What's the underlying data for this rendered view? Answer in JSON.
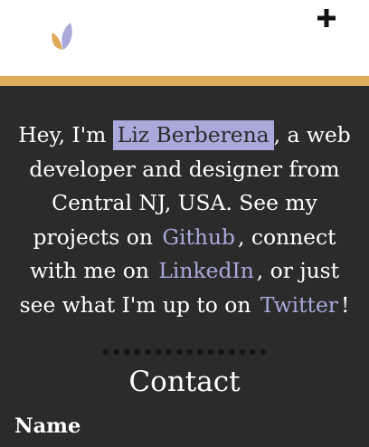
{
  "header": {
    "logo_icon": "leaf-logo-icon",
    "menu_icon": "plus-icon"
  },
  "colors": {
    "header_bg": "#ffffff",
    "accent_bar": "#ddab5a",
    "page_bg": "#2b2b2b",
    "text": "#ffffff",
    "link": "#aaa9dc",
    "highlight_bg": "#aaa9dc"
  },
  "intro": {
    "greeting": "Hey, I'm",
    "name": "Liz Berberena",
    "text_after_name": ", a web developer and designer from Central NJ, USA. See my projects on",
    "github_link": "Github",
    "text_after_github": ", connect with me on",
    "linkedin_link": "LinkedIn",
    "text_after_linkedin": ", or just see what I'm up to on",
    "twitter_link": "Twitter",
    "closing": "!"
  },
  "contact": {
    "title": "Contact",
    "name_label": "Name"
  }
}
